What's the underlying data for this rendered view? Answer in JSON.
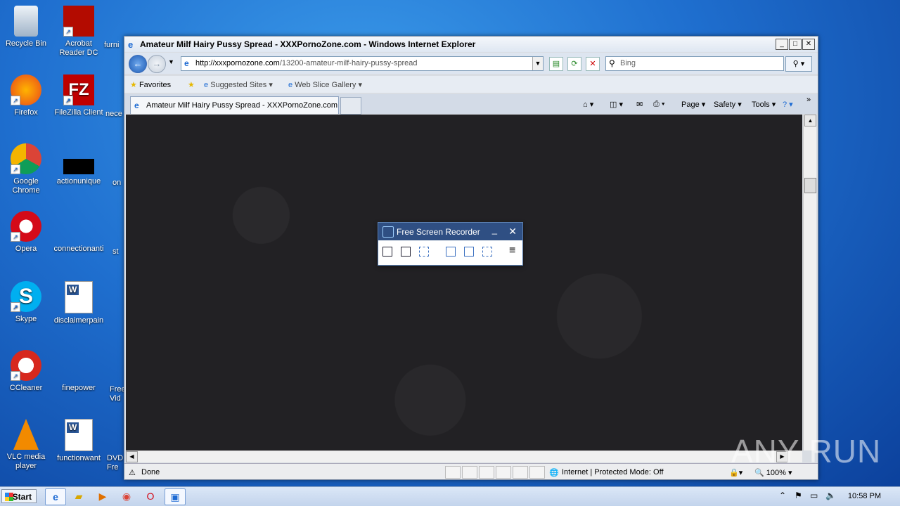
{
  "desktop": {
    "icons": [
      {
        "label": "Recycle Bin"
      },
      {
        "label": "Acrobat Reader DC"
      },
      {
        "label": "furni"
      },
      {
        "label": "Firefox"
      },
      {
        "label": "FileZilla Client"
      },
      {
        "label": "nece"
      },
      {
        "label": "Google Chrome"
      },
      {
        "label": "actionunique"
      },
      {
        "label": "on"
      },
      {
        "label": "Opera"
      },
      {
        "label": "connectionanti"
      },
      {
        "label": "st"
      },
      {
        "label": "Skype"
      },
      {
        "label": "disclaimerpain"
      },
      {
        "label": "CCleaner"
      },
      {
        "label": "finepower"
      },
      {
        "label": "Free Vid"
      },
      {
        "label": "VLC media player"
      },
      {
        "label": "functionwant"
      },
      {
        "label": "DVD Fre"
      }
    ]
  },
  "window": {
    "title": "Amateur Milf Hairy Pussy Spread - XXXPornoZone.com - Windows Internet Explorer",
    "address_host": "http://xxxpornozone.com",
    "address_path": "/13200-amateur-milf-hairy-pussy-spread",
    "search_placeholder": "Bing",
    "favorites_label": "Favorites",
    "suggested_sites": "Suggested Sites",
    "web_slice_gallery": "Web Slice Gallery",
    "tab_title": "Amateur Milf Hairy Pussy Spread - XXXPornoZone.com",
    "cmd_page": "Page",
    "cmd_safety": "Safety",
    "cmd_tools": "Tools",
    "status_text": "Done",
    "status_zone": "Internet | Protected Mode: Off",
    "zoom": "100%"
  },
  "recorder": {
    "title": "Free Screen Recorder"
  },
  "taskbar": {
    "start_label": "Start",
    "clock": "10:58 PM"
  },
  "watermark": "ANY RUN"
}
